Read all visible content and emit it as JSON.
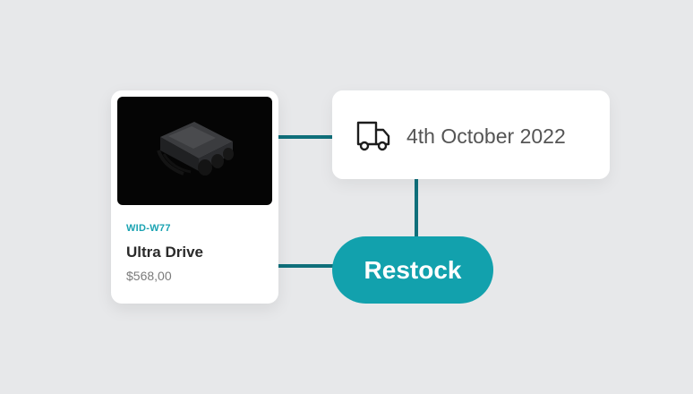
{
  "product": {
    "sku": "WID-W77",
    "name": "Ultra Drive",
    "price": "$568,00",
    "image_icon": "product-device-image"
  },
  "delivery": {
    "icon": "truck-icon",
    "date": "4th October 2022"
  },
  "action": {
    "restock_label": "Restock"
  },
  "colors": {
    "background": "#e7e8ea",
    "accent": "#12a1ad",
    "connector": "#0f6f7a",
    "sku_text": "#1aa3b2"
  }
}
